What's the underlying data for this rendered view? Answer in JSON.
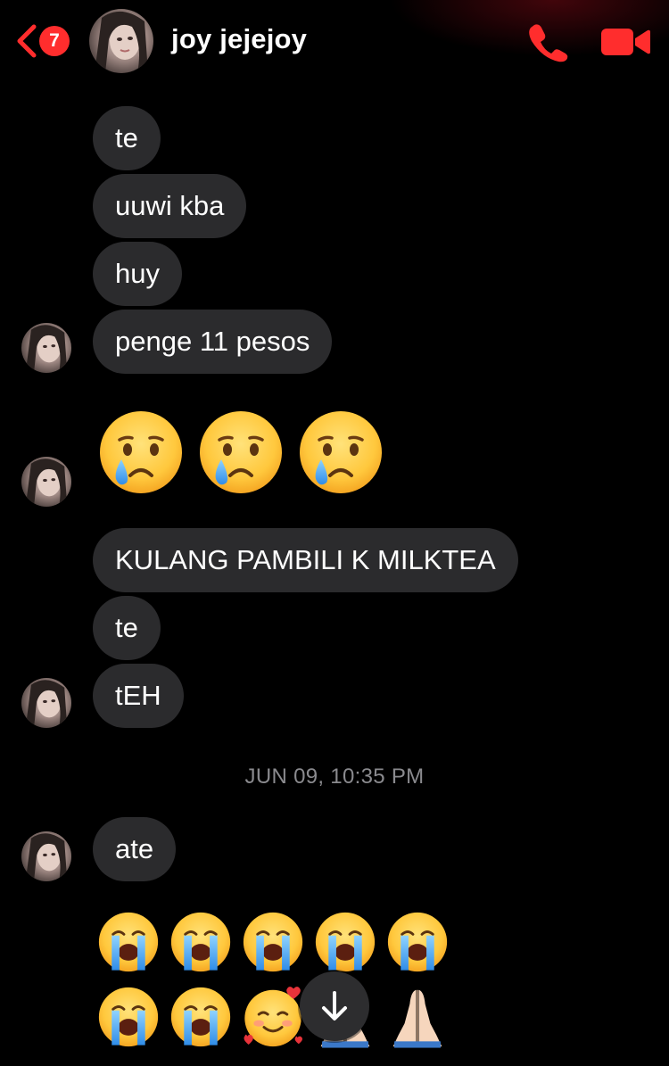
{
  "header": {
    "unread_count": "7",
    "contact_name": "joy jejejoy",
    "accent_color": "#ff2d2d"
  },
  "icons": {
    "back": "chevron-left-icon",
    "call": "phone-icon",
    "video": "video-camera-icon",
    "scroll": "arrow-down-icon"
  },
  "messages": {
    "m1": "te",
    "m2": "uuwi kba",
    "m3": "huy",
    "m4": "penge 11 pesos",
    "m5": "KULANG PAMBILI K MILKTEA",
    "m6": "te",
    "m7": "tEH",
    "m8": "ate"
  },
  "timestamp": "JUN 09, 10:35 PM",
  "emoji_messages": {
    "row1": [
      "crying-face",
      "crying-face",
      "crying-face"
    ],
    "row2": [
      "loudly-crying-face",
      "loudly-crying-face",
      "loudly-crying-face",
      "loudly-crying-face",
      "loudly-crying-face"
    ],
    "row3": [
      "loudly-crying-face",
      "loudly-crying-face",
      "smiling-face-with-hearts",
      "folded-hands",
      "folded-hands"
    ]
  }
}
